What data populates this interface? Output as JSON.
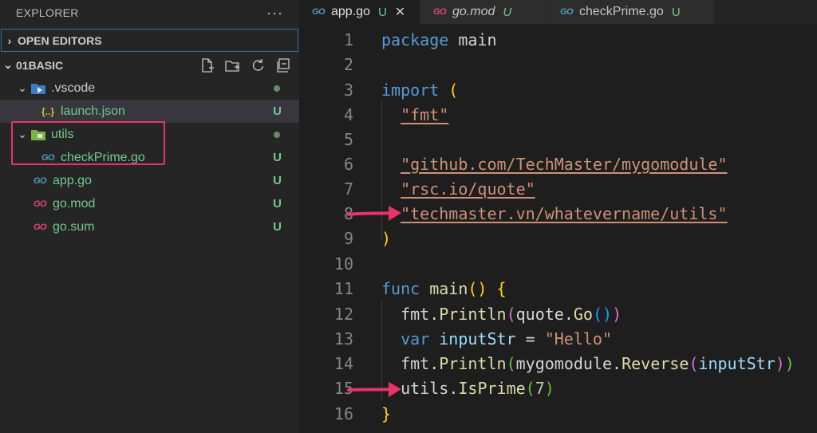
{
  "sidebar": {
    "title": "EXPLORER",
    "more": "···",
    "open_editors": "OPEN EDITORS",
    "project": "01BASIC",
    "tree": [
      {
        "name": ".vscode",
        "type": "folder",
        "status": ""
      },
      {
        "name": "launch.json",
        "type": "json",
        "icon": "{..}",
        "status": "U"
      },
      {
        "name": "utils",
        "type": "folder",
        "status": ""
      },
      {
        "name": "checkPrime.go",
        "type": "go",
        "status": "U"
      },
      {
        "name": "app.go",
        "type": "go",
        "status": "U"
      },
      {
        "name": "go.mod",
        "type": "gomod",
        "status": "U"
      },
      {
        "name": "go.sum",
        "type": "gomod",
        "status": "U"
      }
    ]
  },
  "tabs": [
    {
      "icon": "GO",
      "name": "app.go",
      "status": "U",
      "close": "✕"
    },
    {
      "icon": "GO",
      "name": "go.mod",
      "status": "U"
    },
    {
      "icon": "GO",
      "name": "checkPrime.go",
      "status": "U"
    }
  ],
  "editor": {
    "line_numbers": [
      "1",
      "2",
      "3",
      "4",
      "5",
      "6",
      "7",
      "8",
      "9",
      "10",
      "11",
      "12",
      "13",
      "14",
      "15",
      "16"
    ],
    "tokens": {
      "package": "package",
      "main": "main",
      "import": "import",
      "open_paren": "(",
      "close_paren": ")",
      "fmt_str": "\"fmt\"",
      "mygomodule_str": "\"github.com/TechMaster/mygomodule\"",
      "quote_str": "\"rsc.io/quote\"",
      "utils_str": "\"techmaster.vn/whatevername/utils\"",
      "func": "func",
      "main_fn": "main",
      "parens": "()",
      "brace_open": "{",
      "brace_close": "}",
      "fmt": "fmt",
      "dot": ".",
      "println": "Println",
      "quote": "quote",
      "go_fn": "Go",
      "var": "var",
      "inputStr": "inputStr",
      "eq": " = ",
      "hello": "\"Hello\"",
      "mygomodule": "mygomodule",
      "reverse": "Reverse",
      "utils": "utils",
      "isprime": "IsPrime",
      "seven": "7"
    }
  },
  "colors": {
    "accent_highlight": "#e8336b",
    "git_untracked": "#73c991",
    "go_icon": "#519aba",
    "gomod_icon": "#e0447c"
  }
}
